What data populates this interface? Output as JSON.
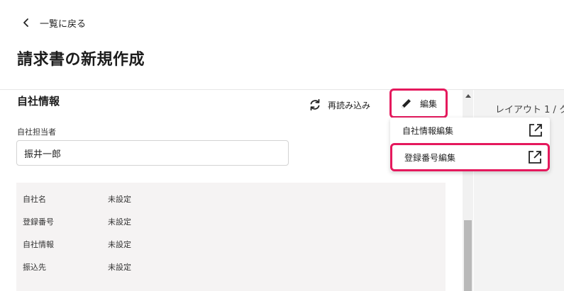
{
  "header": {
    "back_label": "一覧に戻る",
    "title": "請求書の新規作成"
  },
  "section": {
    "title": "自社情報",
    "reload_label": "再読み込み",
    "edit_label": "編集"
  },
  "form": {
    "owner_label": "自社担当者",
    "owner_value": "振井一郎"
  },
  "info_rows": [
    {
      "key": "自社名",
      "value": "未設定"
    },
    {
      "key": "登録番号",
      "value": "未設定"
    },
    {
      "key": "自社情報",
      "value": "未設定"
    },
    {
      "key": "振込先",
      "value": "未設定"
    }
  ],
  "dropdown": {
    "items": [
      {
        "label": "自社情報編集"
      },
      {
        "label": "登録番号編集"
      }
    ]
  },
  "right_panel": {
    "layout_label": "レイアウト 1 / ク"
  },
  "colors": {
    "highlight": "#e5195d"
  }
}
